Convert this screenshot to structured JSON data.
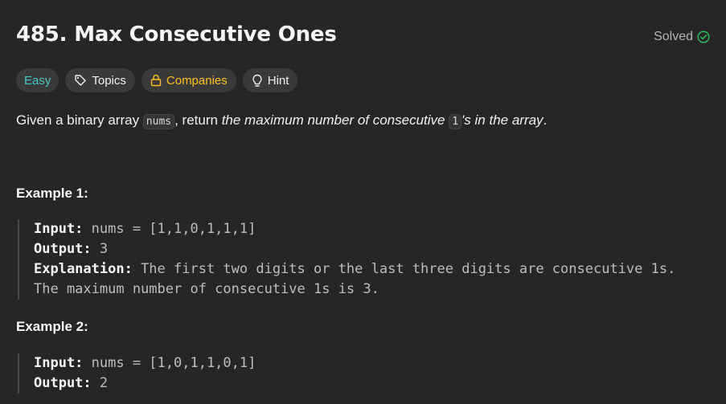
{
  "problem": {
    "title": "485. Max Consecutive Ones",
    "status": "Solved"
  },
  "tags": {
    "difficulty": "Easy",
    "topics": "Topics",
    "companies": "Companies",
    "hint": "Hint"
  },
  "description": {
    "part1": "Given a binary array ",
    "code1": "nums",
    "part2": ", return ",
    "italic1": "the maximum number of consecutive ",
    "code2": "1",
    "italic2": "'s in the array",
    "end": "."
  },
  "examples": [
    {
      "heading": "Example 1:",
      "input_label": "Input:",
      "input_value": " nums = [1,1,0,1,1,1]",
      "output_label": "Output:",
      "output_value": " 3",
      "explanation_label": "Explanation:",
      "explanation_value": " The first two digits or the last three digits are consecutive 1s.",
      "explanation_line2": "The maximum number of consecutive 1s is 3."
    },
    {
      "heading": "Example 2:",
      "input_label": "Input:",
      "input_value": " nums = [1,0,1,1,0,1]",
      "output_label": "Output:",
      "output_value": " 2"
    }
  ],
  "colors": {
    "background": "#262626",
    "easy": "#46c6c2",
    "companies": "#ffc01e",
    "solved_check": "#2cbb5d"
  },
  "icons": {
    "solved": "check-circle-icon",
    "topics": "tag-icon",
    "companies": "lock-icon",
    "hint": "lightbulb-icon"
  }
}
